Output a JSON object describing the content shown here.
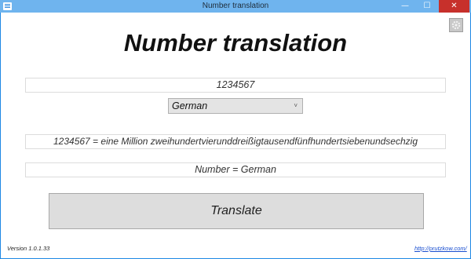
{
  "window": {
    "title": "Number translation",
    "controls": {
      "minimize": "—",
      "maximize": "☐",
      "close": "✕"
    }
  },
  "app": {
    "heading": "Number translation",
    "settings_icon": "gear-icon",
    "number_input": {
      "value": "1234567"
    },
    "language_select": {
      "selected": "German",
      "chevron": "˅"
    },
    "result": {
      "value": "1234567 = eine Million zweihundertvierunddreißigtausendfünfhundertsiebenundsechzig"
    },
    "status": {
      "value": "Number = German"
    },
    "translate_button": {
      "label": "Translate"
    },
    "footer": {
      "version": "Version 1.0.1.33",
      "link": "http://prutzkow.com/"
    }
  }
}
